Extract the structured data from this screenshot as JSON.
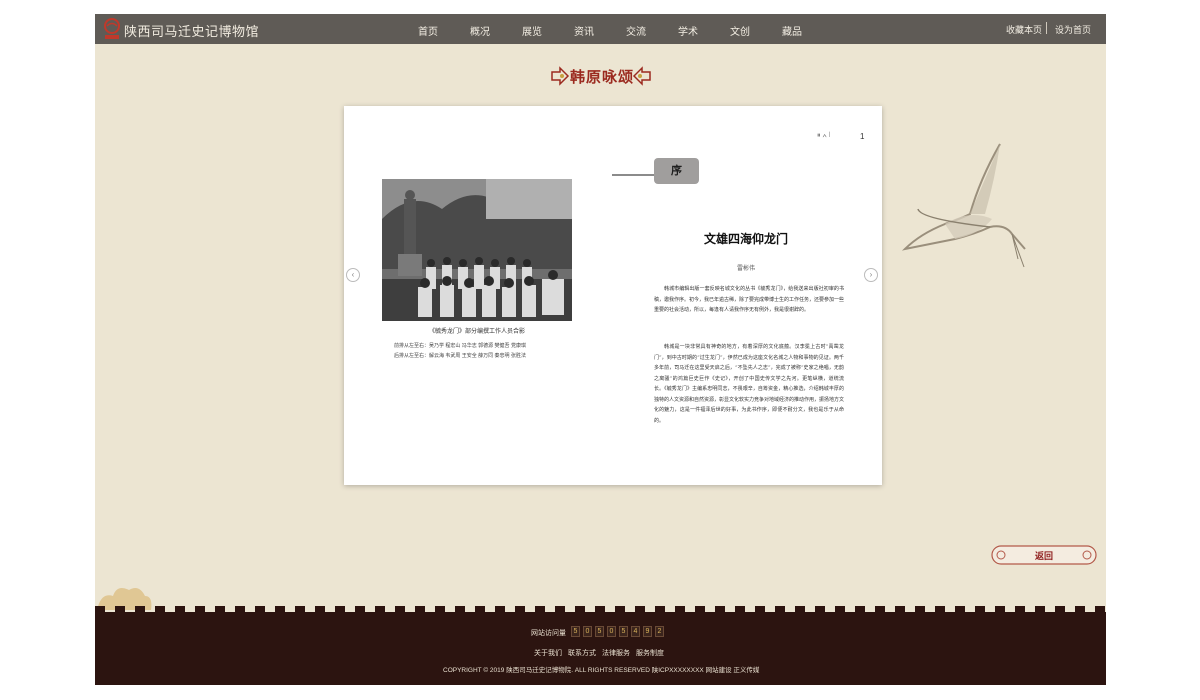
{
  "header": {
    "site_title": "陕西司马迁史记博物馆",
    "nav": [
      "首页",
      "概况",
      "展览",
      "资讯",
      "交流",
      "学术",
      "文创",
      "藏品"
    ],
    "bookmark": "收藏本页",
    "set_home": "设为首页"
  },
  "section_title": "韩原咏颂",
  "book": {
    "page_indicator": "⏸ ∧ ∣",
    "page_number": "1",
    "photo_caption": "《毓秀龙门》部分编撰工作人员合影",
    "names_front": "前排从左至右：吴乃学  程宏山  冯华志  郭德源  樊健吾  党康琪",
    "names_back": "后排从左至右：解云海  韦武周  王安全  薛万同  秦忠明  张胜法",
    "preface_tab": "序",
    "article_title": "文雄四海仰龙门",
    "author": "雷彬伟",
    "paragraphs": [
      "韩城市编辑出版一套反映名城文化的丛书《毓秀龙门》，给我送来出版社初审的书稿，邀我作序。初今，我已年逾古稀，除了要完成带博士生的工作任务，还要参加一些重要的社会活动，所以，每逢有人请我作序无有例外，我是很谢辞的。",
      "韩城是一块非常具有神奇的地方，有着深厚的文化底蕴。汉李冕上古时“禹凿龙门”，到中古时期的“过生龙门”，伊然已成为这座文化名城之人物和事物的见证。两千多年前，司马迁在这里受天启之后，“不坠先人之志”，完成了被称“史家之绝唱，无韵之离骚”的鸿篇巨史巨作《史记》，开创了中国史传文学之先河。更笔纵横，道统流长。《毓秀龙门》主编系忠明同志，不畏艰辛，自筹资金，精心推选，介绍韩城丰厚的独特的人文资源和自然资源，彰显文化软实力竞争对地域经济的推动作用，振扬地方文化的魅力，这是一件福泽后世的好事，为此书作序，即便不耐分文，我也是乐于从命的。"
    ]
  },
  "back_button": "返回",
  "footer": {
    "visit_label": "网站访问量",
    "visit_digits": [
      "5",
      "0",
      "5",
      "0",
      "5",
      "4",
      "9",
      "2"
    ],
    "links": [
      "关于我们",
      "联系方式",
      "法律服务",
      "服务制度"
    ],
    "copyright": "COPYRIGHT © 2019 陕西司马迁史记博物院. ALL RIGHTS RESERVED  陕ICPXXXXXXXX    网站建设 正义传媒"
  },
  "colors": {
    "header_bg": "#5f5b56",
    "page_bg": "#ece5d2",
    "accent_red": "#9b2a1f",
    "footer_bg": "#2c1410"
  }
}
